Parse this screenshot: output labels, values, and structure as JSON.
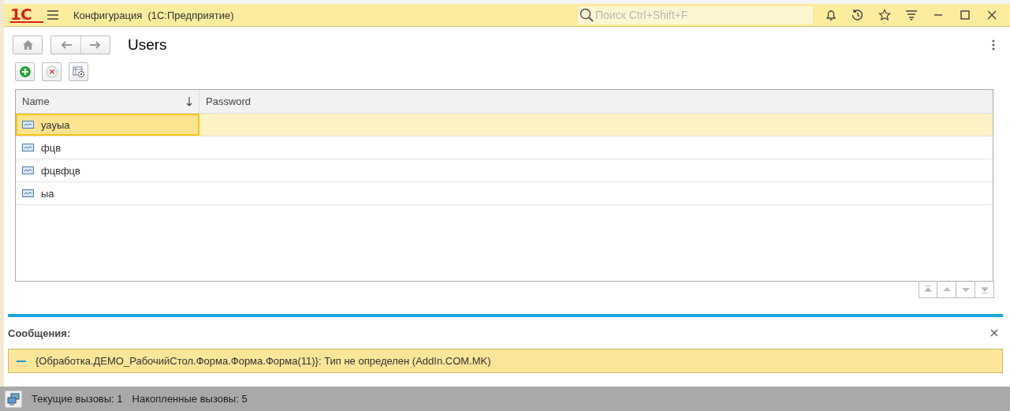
{
  "window": {
    "logo": "1С",
    "title": "Конфигурация  (1С:Предприятие)",
    "search": {
      "placeholder": "Поиск Ctrl+Shift+F"
    }
  },
  "form": {
    "title": "Users"
  },
  "table": {
    "columns": [
      {
        "label": "Name",
        "sorted_descending": true
      },
      {
        "label": "Password",
        "sorted_descending": false
      }
    ],
    "rows": [
      {
        "name": "уауыа",
        "selected": true
      },
      {
        "name": "фцв",
        "selected": false
      },
      {
        "name": "фцвфцв",
        "selected": false
      },
      {
        "name": "ыа",
        "selected": false
      }
    ]
  },
  "messages": {
    "title": "Сообщения:",
    "items": [
      {
        "text": "{Обработка.ДЕМО_РабочийСтол.Форма.Форма.Форма(11)}: Тип не определен (AddIn.COM.MK)"
      }
    ]
  },
  "status_bar": {
    "items": [
      "Текущие вызовы: 1",
      "Накопленные вызовы: 5"
    ]
  }
}
